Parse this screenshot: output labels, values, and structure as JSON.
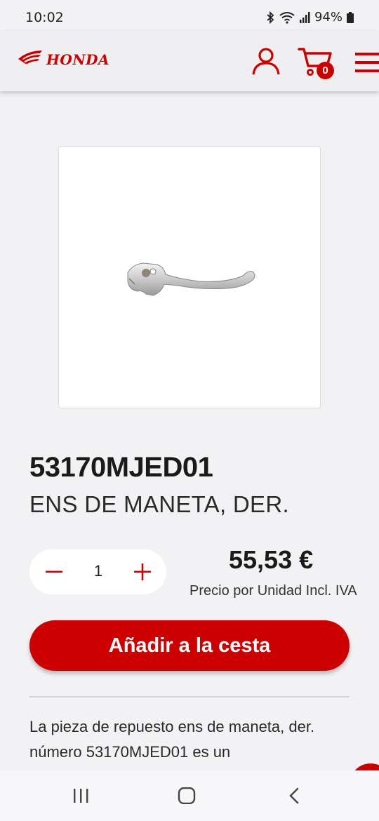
{
  "status_bar": {
    "time": "10:02",
    "battery": "94%",
    "icons": [
      "bluetooth-icon",
      "wifi-icon",
      "signal-icon",
      "battery-icon"
    ]
  },
  "header": {
    "brand": "HONDA",
    "cart_count": "0",
    "icons": [
      "honda-wing-logo",
      "user-icon",
      "cart-icon",
      "menu-icon"
    ]
  },
  "product": {
    "part_number": "53170MJED01",
    "name": "ENS DE MANETA, DER.",
    "image_icon": "brake-lever-image",
    "quantity": "1",
    "price": "55,53 €",
    "price_note": "Precio por Unidad Incl. IVA",
    "add_to_cart_label": "Añadir a la cesta",
    "description": "La pieza de repuesto ens de maneta, der. número 53170MJED01 es un"
  },
  "colors": {
    "brand_red": "#cc0000",
    "background": "#f2f2f4",
    "text": "#1c1c1c"
  },
  "nav": {
    "icons": [
      "recent-apps-icon",
      "home-icon",
      "back-icon"
    ]
  }
}
